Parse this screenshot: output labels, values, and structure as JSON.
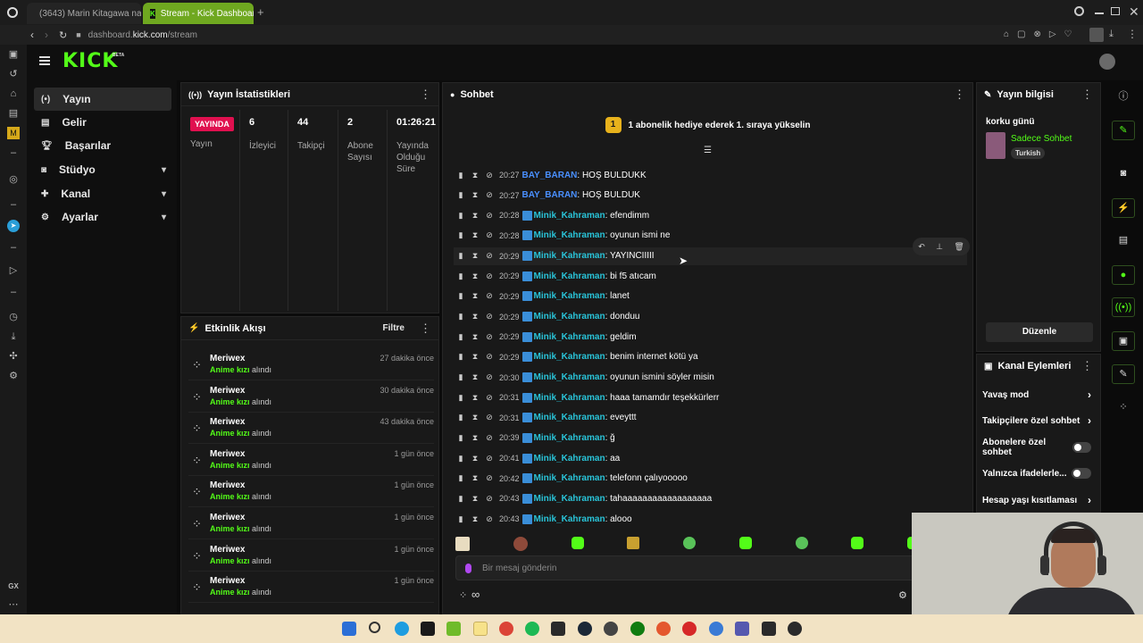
{
  "browser": {
    "tabs": [
      {
        "label": "(3643) Marin Kitagawa na"
      },
      {
        "label": "Stream - Kick Dashboard"
      }
    ],
    "new_tab": "+",
    "url_prefix": "dashboard.",
    "url_domain": "kick.com",
    "url_path": "/stream"
  },
  "brand": {
    "logo": "KICK",
    "beta": "BETA"
  },
  "nav": {
    "items": [
      {
        "label": "Yayın",
        "icon": "broadcast-icon"
      },
      {
        "label": "Gelir",
        "icon": "revenue-icon"
      },
      {
        "label": "Başarılar",
        "icon": "trophy-icon"
      },
      {
        "label": "Stüdyo",
        "icon": "studio-icon"
      },
      {
        "label": "Kanal",
        "icon": "channel-icon"
      },
      {
        "label": "Ayarlar",
        "icon": "gear-icon"
      }
    ]
  },
  "stats": {
    "title": "Yayın İstatistikleri",
    "live_badge": "YAYINDA",
    "live_label": "Yayın",
    "cols": [
      {
        "value": "6",
        "label": "İzleyici"
      },
      {
        "value": "44",
        "label": "Takipçi"
      },
      {
        "value": "2",
        "label": "Abone Sayısı"
      },
      {
        "value": "01:26:21",
        "label": "Yayında Olduğu Süre"
      }
    ]
  },
  "activity": {
    "title": "Etkinlik Akışı",
    "filter": "Filtre",
    "items": [
      {
        "name": "Meriwex",
        "reward": "Anime kızı",
        "suffix": "alındı",
        "time": "27 dakika önce"
      },
      {
        "name": "Meriwex",
        "reward": "Anime kızı",
        "suffix": "alındı",
        "time": "30 dakika önce"
      },
      {
        "name": "Meriwex",
        "reward": "Anime kızı",
        "suffix": "alındı",
        "time": "43 dakika önce"
      },
      {
        "name": "Meriwex",
        "reward": "Anime kızı",
        "suffix": "alındı",
        "time": "1 gün önce"
      },
      {
        "name": "Meriwex",
        "reward": "Anime kızı",
        "suffix": "alındı",
        "time": "1 gün önce"
      },
      {
        "name": "Meriwex",
        "reward": "Anime kızı",
        "suffix": "alındı",
        "time": "1 gün önce"
      },
      {
        "name": "Meriwex",
        "reward": "Anime kızı",
        "suffix": "alındı",
        "time": "1 gün önce"
      },
      {
        "name": "Meriwex",
        "reward": "Anime kızı",
        "suffix": "alındı",
        "time": "1 gün önce"
      }
    ]
  },
  "chat": {
    "title": "Sohbet",
    "pinned_badge": "1",
    "pinned": "1 abonelik hediye ederek 1. sıraya yükselin",
    "messages": [
      {
        "time": "20:27",
        "user": "BAY_BARAN",
        "text": ": HOŞ BULDUKK",
        "color": "u2",
        "badge": false
      },
      {
        "time": "20:27",
        "user": "BAY_BARAN",
        "text": ": HOŞ BULDUK",
        "color": "u2",
        "badge": false
      },
      {
        "time": "20:28",
        "user": "Minik_Kahraman",
        "text": ": efendimm",
        "color": "u1",
        "badge": true
      },
      {
        "time": "20:28",
        "user": "Minik_Kahraman",
        "text": ": oyunun ismi ne",
        "color": "u1",
        "badge": true
      },
      {
        "time": "20:29",
        "user": "Minik_Kahraman",
        "text": ": YAYINCIIIII",
        "color": "u1",
        "badge": true
      },
      {
        "time": "20:29",
        "user": "Minik_Kahraman",
        "text": ": bi f5 atıcam",
        "color": "u1",
        "badge": true
      },
      {
        "time": "20:29",
        "user": "Minik_Kahraman",
        "text": ": lanet",
        "color": "u1",
        "badge": true
      },
      {
        "time": "20:29",
        "user": "Minik_Kahraman",
        "text": ": donduu",
        "color": "u1",
        "badge": true
      },
      {
        "time": "20:29",
        "user": "Minik_Kahraman",
        "text": ": geldim",
        "color": "u1",
        "badge": true
      },
      {
        "time": "20:29",
        "user": "Minik_Kahraman",
        "text": ": benim internet kötü ya",
        "color": "u1",
        "badge": true
      },
      {
        "time": "20:30",
        "user": "Minik_Kahraman",
        "text": ": oyunun ismini söyler misin",
        "color": "u1",
        "badge": true
      },
      {
        "time": "20:31",
        "user": "Minik_Kahraman",
        "text": ": haaa tamamdır teşekkürlerr",
        "color": "u1",
        "badge": true
      },
      {
        "time": "20:31",
        "user": "Minik_Kahraman",
        "text": ": eveyttt",
        "color": "u1",
        "badge": true
      },
      {
        "time": "20:39",
        "user": "Minik_Kahraman",
        "text": ": ğ",
        "color": "u1",
        "badge": true
      },
      {
        "time": "20:41",
        "user": "Minik_Kahraman",
        "text": ": aa",
        "color": "u1",
        "badge": true
      },
      {
        "time": "20:42",
        "user": "Minik_Kahraman",
        "text": ": telefonn çalıyooooo",
        "color": "u1",
        "badge": true
      },
      {
        "time": "20:43",
        "user": "Minik_Kahraman",
        "text": ": tahaaaaaaaaaaaaaaaaaa",
        "color": "u1",
        "badge": true
      },
      {
        "time": "20:43",
        "user": "Minik_Kahraman",
        "text": ": alooo",
        "color": "u1",
        "badge": true
      }
    ],
    "input_placeholder": "Bir mesaj gönderin",
    "infinity": "∞"
  },
  "info": {
    "title": "Yayın bilgisi",
    "stream_title": "korku günü",
    "category": "Sadece Sohbet",
    "language": "Turkish",
    "edit_button": "Düzenle"
  },
  "channel_actions": {
    "title": "Kanal Eylemleri",
    "items": [
      {
        "label": "Yavaş mod",
        "kind": "chevron"
      },
      {
        "label": "Takipçilere özel sohbet",
        "kind": "chevron"
      },
      {
        "label": "Abonelere özel sohbet",
        "kind": "toggle",
        "on": false
      },
      {
        "label": "Yalnızca ifadelerle...",
        "kind": "toggle",
        "on": false
      },
      {
        "label": "Hesap yaşı kısıtlaması",
        "kind": "chevron"
      }
    ]
  },
  "side_strip": {
    "gx": "GX"
  },
  "colors": {
    "kick_green": "#53fc18",
    "live_red": "#e0104f",
    "tab_green": "#6fa820",
    "panel_bg": "#191919"
  }
}
